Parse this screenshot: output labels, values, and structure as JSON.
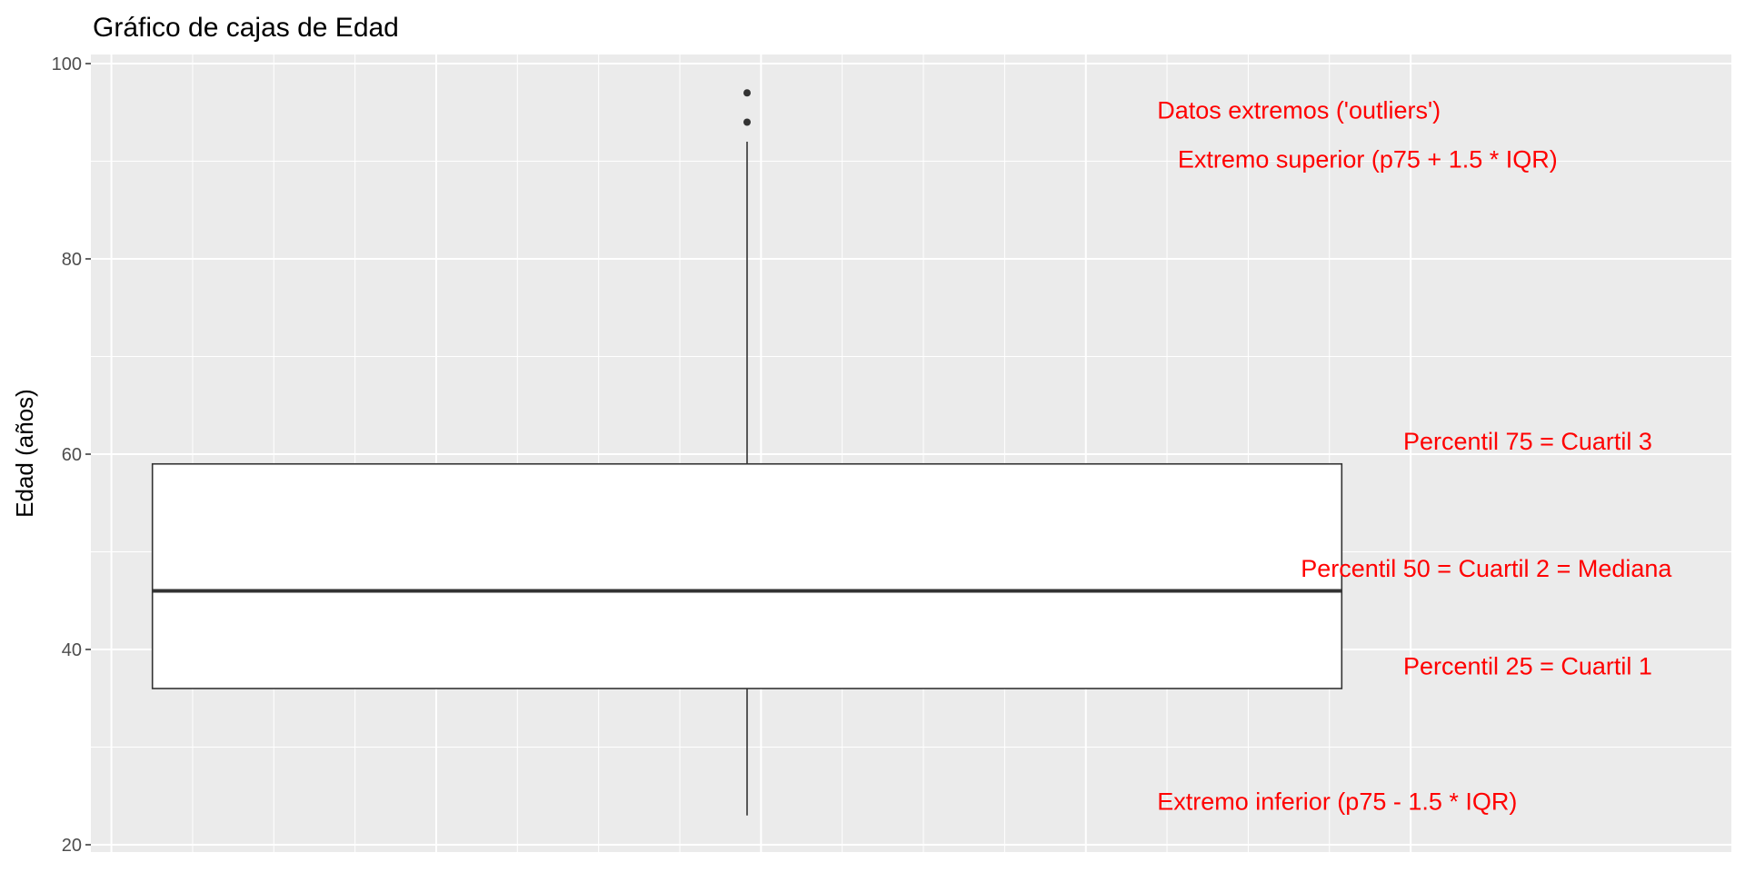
{
  "chart_data": {
    "type": "box",
    "title": "Gráfico de cajas de Edad",
    "xlabel": "",
    "ylabel": "Edad (años)",
    "ylim": [
      20,
      100
    ],
    "yticks": [
      "20",
      "40",
      "60",
      "80",
      "100"
    ],
    "grid": true,
    "background_color": "#ebebeb",
    "annotation_color": "#ff0000",
    "box": {
      "whisker_low": 23,
      "q1": 36,
      "median": 46,
      "q3": 59,
      "whisker_high": 92,
      "outliers": [
        94,
        97
      ]
    },
    "annotations": [
      {
        "text": "Datos extremos ('outliers')",
        "x": 0.65,
        "y": 95.2
      },
      {
        "text": "Extremo superior (p75 + 1.5 * IQR)",
        "x": 0.6625,
        "y": 90.2
      },
      {
        "text": "Percentil 75 = Cuartil 3",
        "x": 0.8,
        "y": 61.3
      },
      {
        "text": "Percentil 50 = Cuartil 2 = Mediana",
        "x": 0.7375,
        "y": 48.3
      },
      {
        "text": "Percentil 25 = Cuartil 1",
        "x": 0.8,
        "y": 38.3
      },
      {
        "text": "Extremo inferior (p75 - 1.5 * IQR)",
        "x": 0.65,
        "y": 24.4
      }
    ]
  }
}
